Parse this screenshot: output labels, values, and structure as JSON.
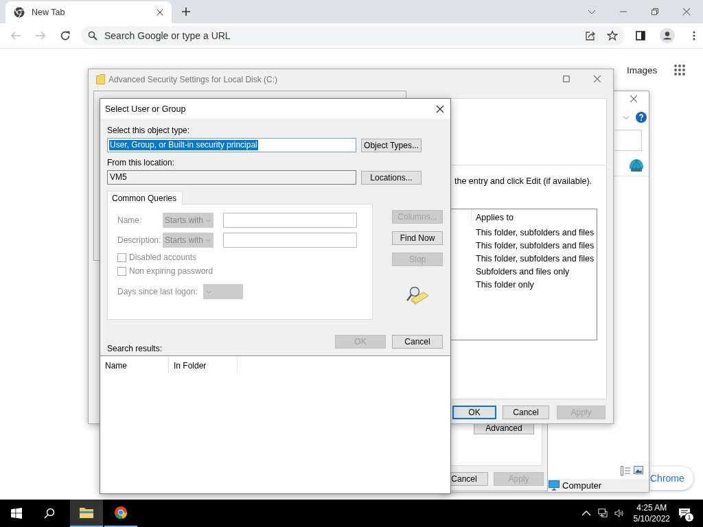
{
  "browser": {
    "tab": {
      "title": "New Tab",
      "selected": true
    },
    "omnibox": {
      "placeholder": "Search Google or type a URL"
    },
    "header_links": [
      "Images"
    ],
    "customize_button": "Chrome"
  },
  "explorer_window": {
    "status": "Computer"
  },
  "properties_window": {
    "advanced_button": {
      "label": "Advanced",
      "disabled": false
    },
    "buttons": [
      {
        "label": "Cancel",
        "disabled": false
      },
      {
        "label": "Apply",
        "disabled": true
      }
    ]
  },
  "security_window": {
    "title": "Advanced Security Settings for Local Disk (C:)",
    "instruction": "the entry and click Edit (if available).",
    "table": {
      "columns": [
        "Applies to"
      ],
      "rows": [
        "This folder, subfolders and files",
        "This folder, subfolders and files",
        "This folder, subfolders and files",
        "Subfolders and files only",
        "This folder only"
      ]
    },
    "buttons": [
      {
        "label": "OK",
        "disabled": false,
        "default": true
      },
      {
        "label": "Cancel",
        "disabled": false,
        "default": false
      },
      {
        "label": "Apply",
        "disabled": true,
        "default": false
      }
    ]
  },
  "select_dialog": {
    "title": "Select User or Group",
    "object_type": {
      "label": "Select this object type:",
      "value": "User, Group, or Built-in security principal",
      "selected": true,
      "button": {
        "label": "Object Types...",
        "disabled": false
      }
    },
    "location": {
      "label": "From this location:",
      "value": "VM5",
      "button": {
        "label": "Locations...",
        "disabled": false
      }
    },
    "queries": {
      "tab": {
        "label": "Common Queries",
        "selected": true
      },
      "disabled": true,
      "filters": [
        {
          "label": "Name:",
          "operator": "Starts with"
        },
        {
          "label": "Description:",
          "operator": "Starts with"
        }
      ],
      "checkboxes": [
        {
          "label": "Disabled accounts",
          "checked": false
        },
        {
          "label": "Non expiring password",
          "checked": false
        }
      ],
      "days_label": "Days since last logon:"
    },
    "side_buttons": [
      {
        "label": "Columns...",
        "disabled": true
      },
      {
        "label": "Find Now",
        "disabled": false
      },
      {
        "label": "Stop",
        "disabled": true
      }
    ],
    "buttons": [
      {
        "label": "OK",
        "disabled": true
      },
      {
        "label": "Cancel",
        "disabled": false
      }
    ],
    "results": {
      "label": "Search results:",
      "columns": [
        "Name",
        "In Folder"
      ]
    }
  },
  "taskbar": {
    "apps": [
      {
        "kind": "explorer",
        "selected": true
      },
      {
        "kind": "chrome",
        "selected": false
      }
    ],
    "time": "4:25 AM",
    "date": "5/10/2022",
    "notifications": "1"
  }
}
